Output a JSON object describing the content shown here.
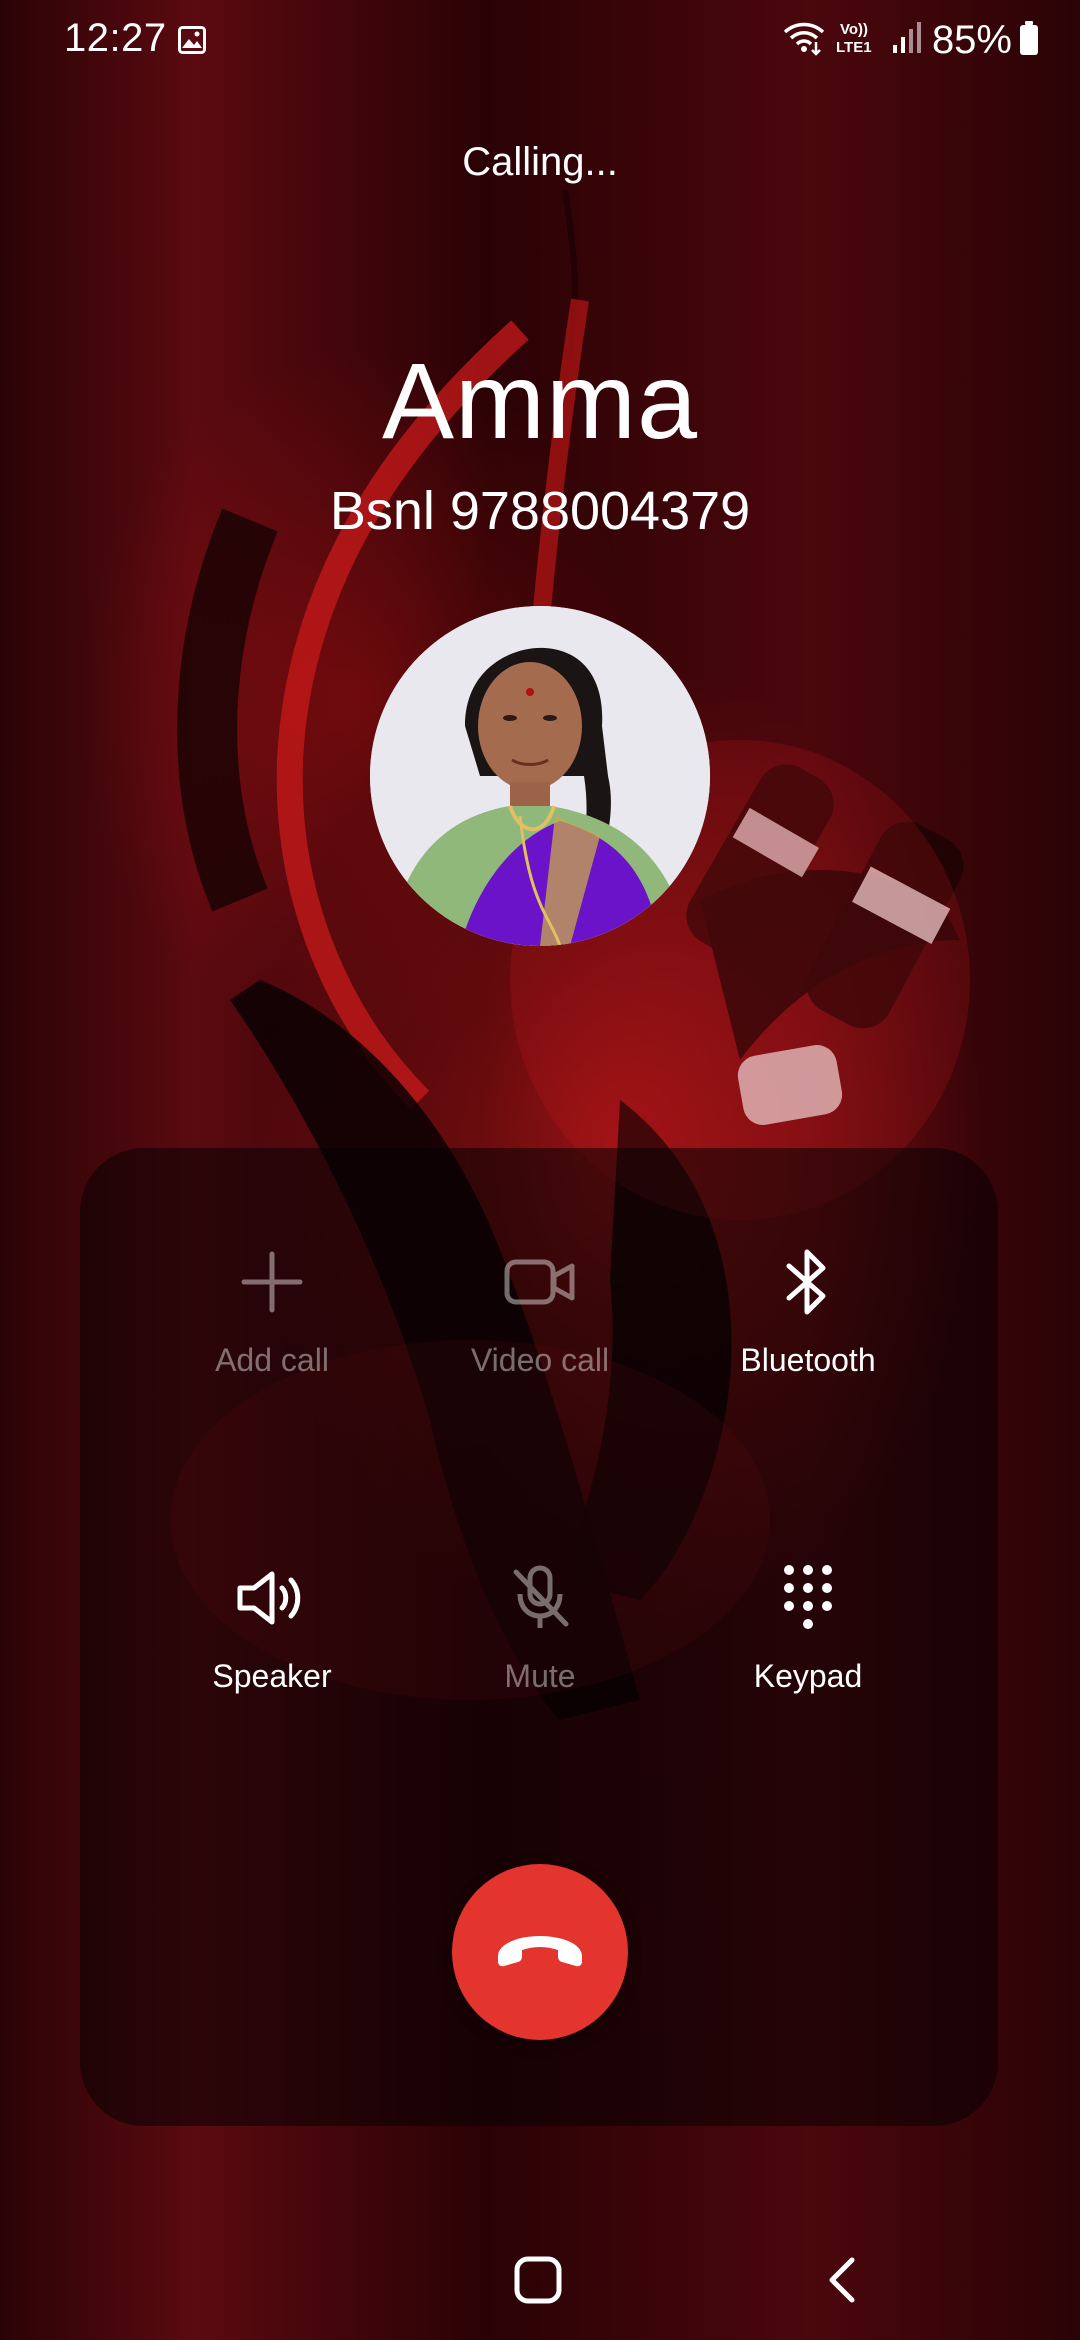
{
  "status_bar": {
    "time": "12:27",
    "network_label": "Vo)) LTE1",
    "battery": "85%"
  },
  "call": {
    "status": "Calling...",
    "contact_name": "Amma",
    "contact_number": "Bsnl 9788004379"
  },
  "controls": [
    {
      "label": "Add call",
      "icon": "plus-icon",
      "enabled": false
    },
    {
      "label": "Video call",
      "icon": "video-camera-icon",
      "enabled": false
    },
    {
      "label": "Bluetooth",
      "icon": "bluetooth-icon",
      "enabled": true
    },
    {
      "label": "Speaker",
      "icon": "speaker-icon",
      "enabled": true
    },
    {
      "label": "Mute",
      "icon": "mic-off-icon",
      "enabled": false
    },
    {
      "label": "Keypad",
      "icon": "keypad-icon",
      "enabled": true
    }
  ],
  "end_call": {
    "icon": "phone-hangup-icon",
    "color": "#e3352d"
  },
  "colors": {
    "background": "#3a0508",
    "accent_red": "#e3352d",
    "panel": "rgba(8,2,3,0.55)"
  }
}
